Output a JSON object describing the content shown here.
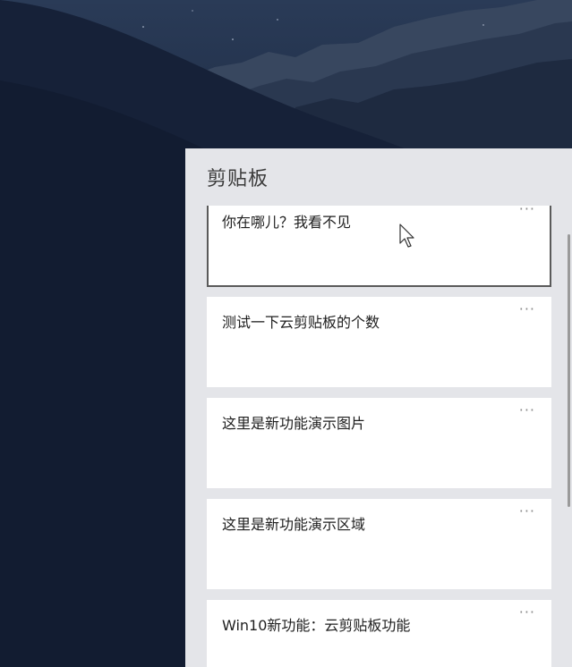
{
  "clipboard": {
    "title": "剪贴板",
    "items": [
      {
        "text": "你在哪儿？我看不见",
        "more": "···",
        "selected": true
      },
      {
        "text": "测试一下云剪贴板的个数",
        "more": "···"
      },
      {
        "text": "这里是新功能演示图片",
        "more": "···"
      },
      {
        "text": "这里是新功能演示区域",
        "more": "···"
      },
      {
        "text": "Win10新功能：云剪贴板功能",
        "more": "···"
      }
    ]
  },
  "colors": {
    "panel_bg": "#e4e5e9",
    "card_bg": "#ffffff",
    "wallpaper": "#14203a"
  },
  "icons": [
    "more-icon",
    "mouse-pointer-icon"
  ]
}
